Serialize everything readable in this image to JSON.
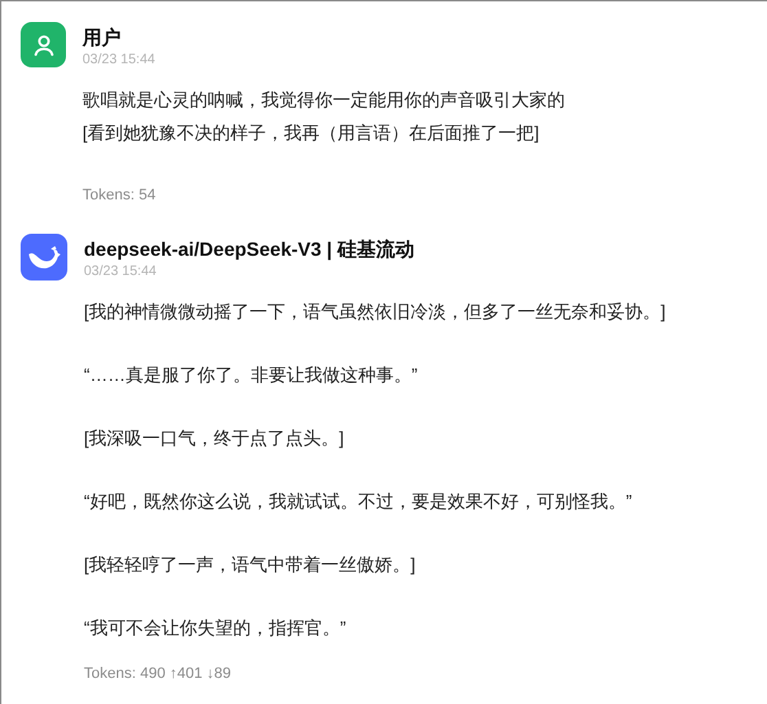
{
  "messages": [
    {
      "kind": "user",
      "author": "用户",
      "time": "03/23 15:44",
      "paragraphs": [
        "歌唱就是心灵的呐喊，我觉得你一定能用你的声音吸引大家的\n[看到她犹豫不决的样子，我再（用言语）在后面推了一把]"
      ],
      "tokens": "Tokens: 54"
    },
    {
      "kind": "assistant",
      "author": "deepseek-ai/DeepSeek-V3 | 硅基流动",
      "time": "03/23 15:44",
      "paragraphs": [
        "[我的神情微微动摇了一下，语气虽然依旧冷淡，但多了一丝无奈和妥协。]",
        "“……真是服了你了。非要让我做这种事。”",
        "[我深吸一口气，终于点了点头。]",
        "“好吧，既然你这么说，我就试试。不过，要是效果不好，可别怪我。”",
        "[我轻轻哼了一声，语气中带着一丝傲娇。]",
        "“我可不会让你失望的，指挥官。”"
      ],
      "tokens": "Tokens: 490 ↑401 ↓89"
    }
  ]
}
